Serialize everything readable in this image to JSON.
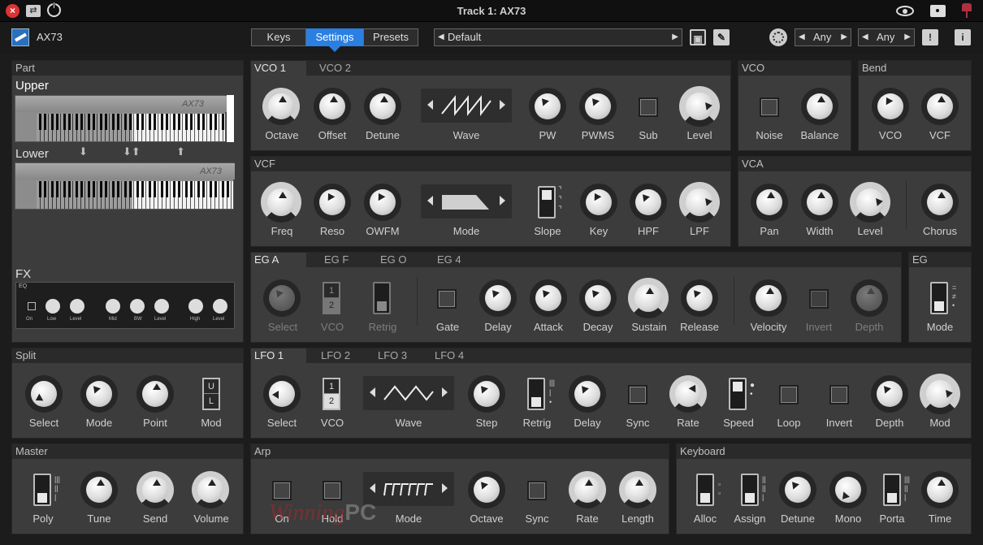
{
  "window": {
    "title": "Track 1: AX73"
  },
  "toolbar": {
    "instrument": "AX73",
    "tabs": [
      "Keys",
      "Settings",
      "Presets"
    ],
    "active_tab": "Settings",
    "preset": "Default",
    "any1": "Any",
    "any2": "Any",
    "warn": "!",
    "info": "i"
  },
  "part": {
    "title": "Part",
    "upper": "Upper",
    "lower": "Lower",
    "kb_brand": "AX73",
    "fx": "FX",
    "fx_eq": "EQ",
    "fx_labels": [
      "On",
      "Low",
      "Level",
      "Mid",
      "BW",
      "Level",
      "High",
      "Level"
    ]
  },
  "vco": {
    "tabs": [
      "VCO 1",
      "VCO 2"
    ],
    "labels": [
      "Octave",
      "Offset",
      "Detune",
      "Wave",
      "PW",
      "PWMS",
      "Sub",
      "Level"
    ]
  },
  "vco_small": {
    "title": "VCO",
    "labels": [
      "Noise",
      "Balance"
    ]
  },
  "bend": {
    "title": "Bend",
    "labels": [
      "VCO",
      "VCF"
    ]
  },
  "vcf": {
    "title": "VCF",
    "labels": [
      "Freq",
      "Reso",
      "OWFM",
      "Mode",
      "Slope",
      "Key",
      "HPF",
      "LPF"
    ]
  },
  "vca": {
    "title": "VCA",
    "labels": [
      "Pan",
      "Width",
      "Level",
      "Chorus"
    ]
  },
  "eg": {
    "tabs": [
      "EG A",
      "EG F",
      "EG O",
      "EG 4"
    ],
    "labels": [
      "Select",
      "VCO",
      "Retrig",
      "Gate",
      "Delay",
      "Attack",
      "Decay",
      "Sustain",
      "Release",
      "Velocity",
      "Invert",
      "Depth"
    ],
    "vco_nums": [
      "1",
      "2"
    ]
  },
  "eg_mode": {
    "title": "EG",
    "label": "Mode"
  },
  "split": {
    "title": "Split",
    "labels": [
      "Select",
      "Mode",
      "Point",
      "Mod"
    ],
    "mod_letters": [
      "U",
      "L"
    ]
  },
  "lfo": {
    "tabs": [
      "LFO 1",
      "LFO 2",
      "LFO 3",
      "LFO 4"
    ],
    "labels": [
      "Select",
      "VCO",
      "Wave",
      "Step",
      "Retrig",
      "Delay",
      "Sync",
      "Rate",
      "Speed",
      "Loop",
      "Invert",
      "Depth",
      "Mod"
    ],
    "vco_nums": [
      "1",
      "2"
    ]
  },
  "master": {
    "title": "Master",
    "labels": [
      "Poly",
      "Tune",
      "Send",
      "Volume"
    ]
  },
  "arp": {
    "title": "Arp",
    "labels": [
      "On",
      "Hold",
      "Mode",
      "Octave",
      "Sync",
      "Rate",
      "Length"
    ]
  },
  "keyboard": {
    "title": "Keyboard",
    "labels": [
      "Alloc",
      "Assign",
      "Detune",
      "Mono",
      "Porta",
      "Time"
    ]
  },
  "watermark": {
    "text1": "Winning",
    "text2": "PC"
  }
}
